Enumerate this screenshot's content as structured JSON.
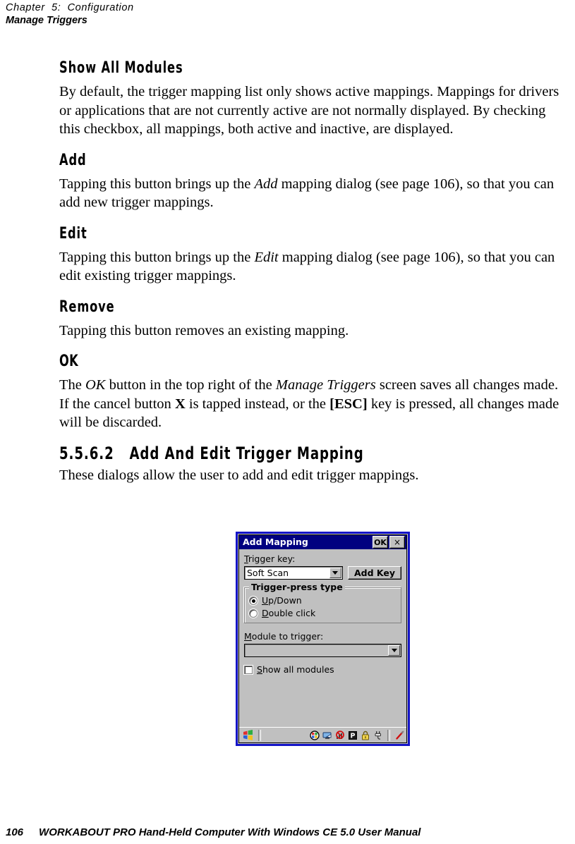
{
  "header": {
    "chapter": "Chapter  5:  Configuration",
    "section": "Manage Triggers"
  },
  "sections": [
    {
      "heading": "Show All Modules",
      "paragraph": "By default, the trigger mapping list only shows active mappings. Mappings for drivers or applications that are not currently active are not normally displayed. By checking this checkbox, all mappings, both active and inactive, are displayed."
    },
    {
      "heading": "Add",
      "para_parts": {
        "p1": "Tapping this button brings up the ",
        "em1": "Add",
        "p2": " mapping dialog (see page 106), so that you can add new trigger mappings."
      }
    },
    {
      "heading": "Edit",
      "para_parts": {
        "p1": "Tapping this button brings up the ",
        "em1": "Edit",
        "p2": " mapping dialog (see page 106), so that you can edit existing trigger mappings."
      }
    },
    {
      "heading": "Remove",
      "paragraph": "Tapping this button removes an existing mapping."
    },
    {
      "heading": "OK",
      "para_parts": {
        "p1": "The ",
        "em1": "OK",
        "p2": " button in the top right of the ",
        "em2": "Manage Triggers",
        "p3": " screen saves all changes made. If the cancel button ",
        "b1": "X",
        "p4": " is tapped instead, or the ",
        "b2": "[ESC]",
        "p5": " key is pressed, all changes made will be discarded."
      }
    }
  ],
  "subsection": {
    "number": "5.5.6.2",
    "title": "Add And Edit Trigger Mapping",
    "intro": "These dialogs allow the user to add and edit trigger mappings."
  },
  "dialog": {
    "title": "Add Mapping",
    "ok_label": "OK",
    "close_label": "×",
    "trigger_key_label_acc": "T",
    "trigger_key_label_rest": "rigger key:",
    "trigger_key_value": "Soft Scan",
    "add_key_label": "Add Key",
    "group_title": "Trigger-press type",
    "radios": [
      {
        "acc": "U",
        "rest": "p/Down",
        "selected": true
      },
      {
        "acc": "D",
        "rest": "ouble click",
        "selected": false
      }
    ],
    "module_label_acc": "M",
    "module_label_rest": "odule to trigger:",
    "module_value": "",
    "checkbox_acc": "S",
    "checkbox_rest": "how all modules",
    "checkbox_checked": false,
    "titlebar_color": "#000080",
    "frame_color": "#1414c8",
    "face_color": "#c0c0c0",
    "taskbar": {
      "start_icon": "windows-flag-icon",
      "tray_icons": [
        "desktop-globe-icon",
        "display-properties-icon",
        "no-signal-icon",
        "power-p-icon",
        "lock-icon",
        "ac-plug-icon",
        "stylus-pen-icon"
      ]
    }
  },
  "footer": {
    "page_number": "106",
    "manual_title": "WORKABOUT PRO Hand-Held Computer With Windows CE 5.0 User Manual"
  }
}
